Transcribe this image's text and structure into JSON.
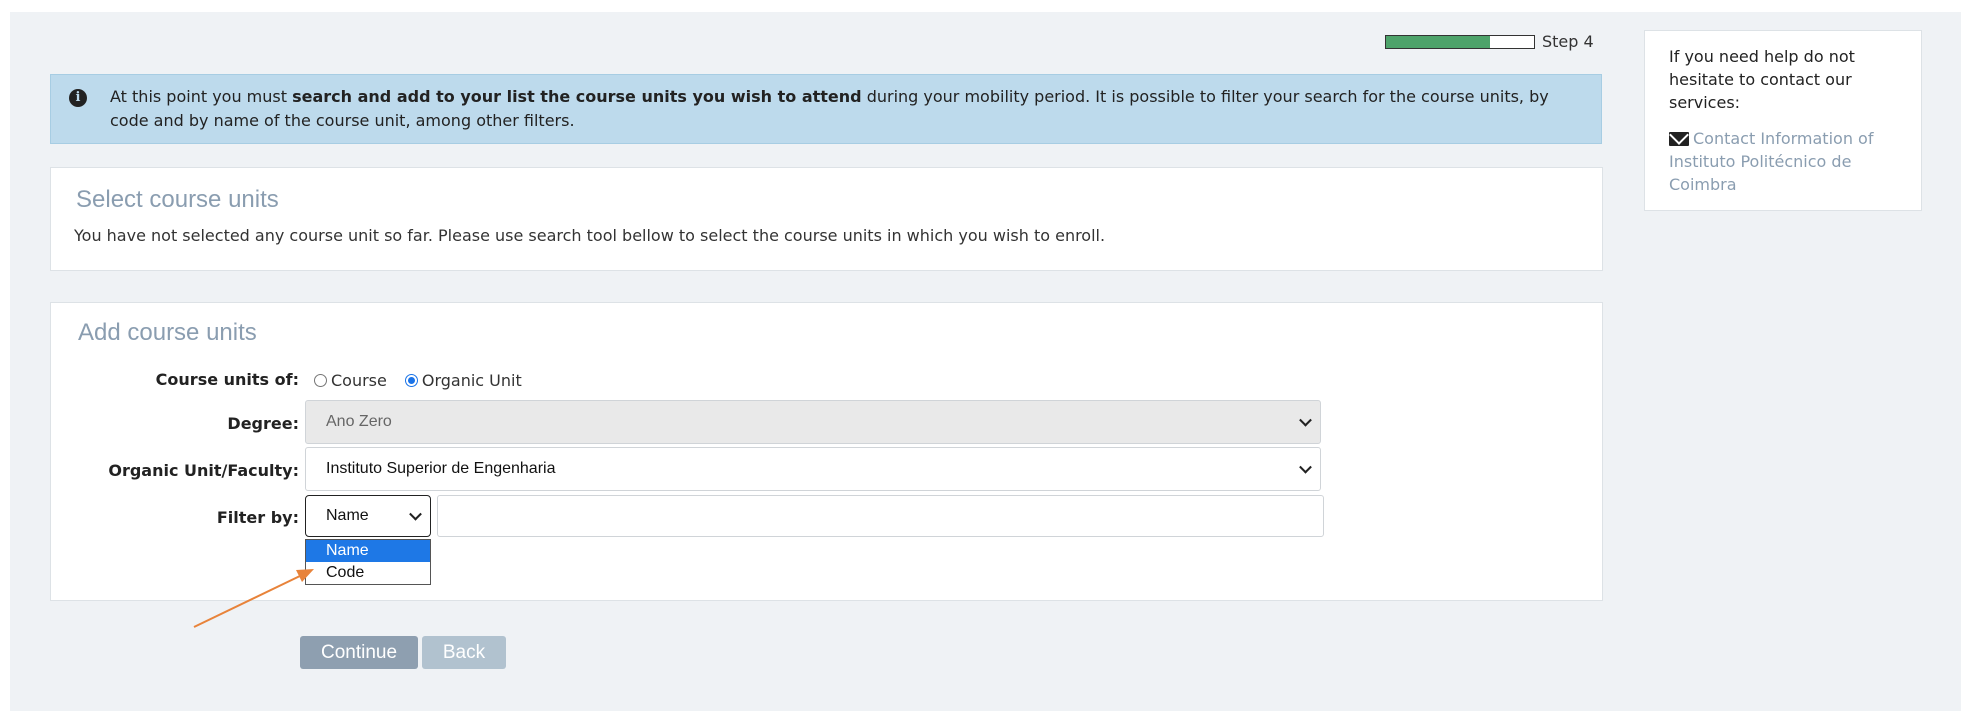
{
  "progress": {
    "label": "Step 4",
    "fraction": 0.7
  },
  "alert": {
    "text_before": "At this point you must ",
    "text_bold": "search and add to your list the course units you wish to attend",
    "text_after": " during your mobility period. It is possible to filter your search for the course units, by code and by name of the course unit, among other filters.",
    "icon": "info-circle-icon"
  },
  "select_panel": {
    "title": "Select course units",
    "message": "You have not selected any course unit so far. Please use search tool bellow to select the course units in which you wish to enroll."
  },
  "add_panel": {
    "title": "Add course units",
    "course_units_of_label": "Course units of:",
    "radio_course": "Course",
    "radio_organic_unit": "Organic Unit",
    "radio_selected": "Organic Unit",
    "degree_label": "Degree:",
    "degree_value": "Ano Zero",
    "org_unit_label": "Organic Unit/Faculty:",
    "org_unit_value": "Instituto Superior de Engenharia",
    "filter_label": "Filter by:",
    "filter_value": "Name",
    "filter_options": [
      "Name",
      "Code"
    ],
    "filter_input_value": ""
  },
  "buttons": {
    "continue": "Continue",
    "back": "Back"
  },
  "help": {
    "text": "If you need help do not hesitate to contact our services:",
    "link": "Contact Information of Instituto Politécnico de Coimbra",
    "icon": "envelope-icon"
  },
  "colors": {
    "progress_fill": "#4da36a",
    "alert_bg": "#bddaec",
    "accent_title": "#8a9db0",
    "dropdown_highlight": "#1e78e6",
    "annotation_arrow": "#e8833a"
  }
}
